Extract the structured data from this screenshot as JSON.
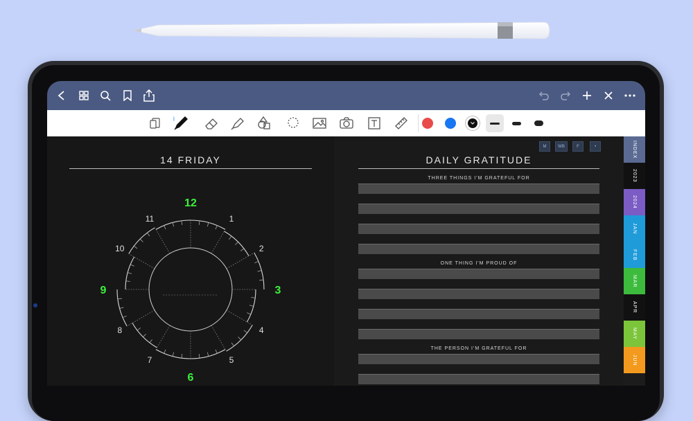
{
  "topbar": {
    "left_icons": [
      "back-chevron-icon",
      "grid-icon",
      "search-icon",
      "bookmark-icon",
      "share-icon"
    ],
    "right_icons": [
      "undo-icon",
      "redo-icon",
      "plus-icon",
      "close-icon",
      "more-icon"
    ]
  },
  "toolbar": {
    "tools": [
      "pages-icon",
      "pen-icon",
      "eraser-icon",
      "highlighter-icon",
      "shapes-icon",
      "lasso-icon",
      "image-icon",
      "camera-icon",
      "text-icon",
      "ruler-icon"
    ],
    "colors": [
      "#e94b4b",
      "#1877f2",
      "#111111"
    ],
    "stroke_sizes": [
      "thin",
      "medium",
      "thick"
    ]
  },
  "left_page": {
    "title": "14 FRIDAY",
    "clock_numbers": [
      "12",
      "1",
      "2",
      "3",
      "4",
      "5",
      "6",
      "7",
      "8",
      "9",
      "10",
      "11"
    ],
    "highlight_color": "#3cf03c"
  },
  "right_page": {
    "title": "DAILY GRATITUDE",
    "nav_buttons": [
      "M",
      "WB",
      "F",
      "•"
    ],
    "sections": [
      {
        "label": "THREE THINGS I'M GRATEFUL FOR"
      },
      {
        "label": "ONE THING I'M PROUD OF"
      },
      {
        "label": "THE PERSON I'M GRATEFUL FOR"
      }
    ]
  },
  "tabs": [
    {
      "label": "INDEX",
      "color": "#5a6a92"
    },
    {
      "label": "2023",
      "color": "#111111"
    },
    {
      "label": "2024",
      "color": "#7b5cc4"
    },
    {
      "label": "JAN",
      "color": "#1f9bd9"
    },
    {
      "label": "FEB",
      "color": "#1f9bd9"
    },
    {
      "label": "MAR",
      "color": "#3dbb3d"
    },
    {
      "label": "APR",
      "color": "#111111"
    },
    {
      "label": "MAY",
      "color": "#7cc43a"
    },
    {
      "label": "JUN",
      "color": "#f39a1e"
    }
  ]
}
